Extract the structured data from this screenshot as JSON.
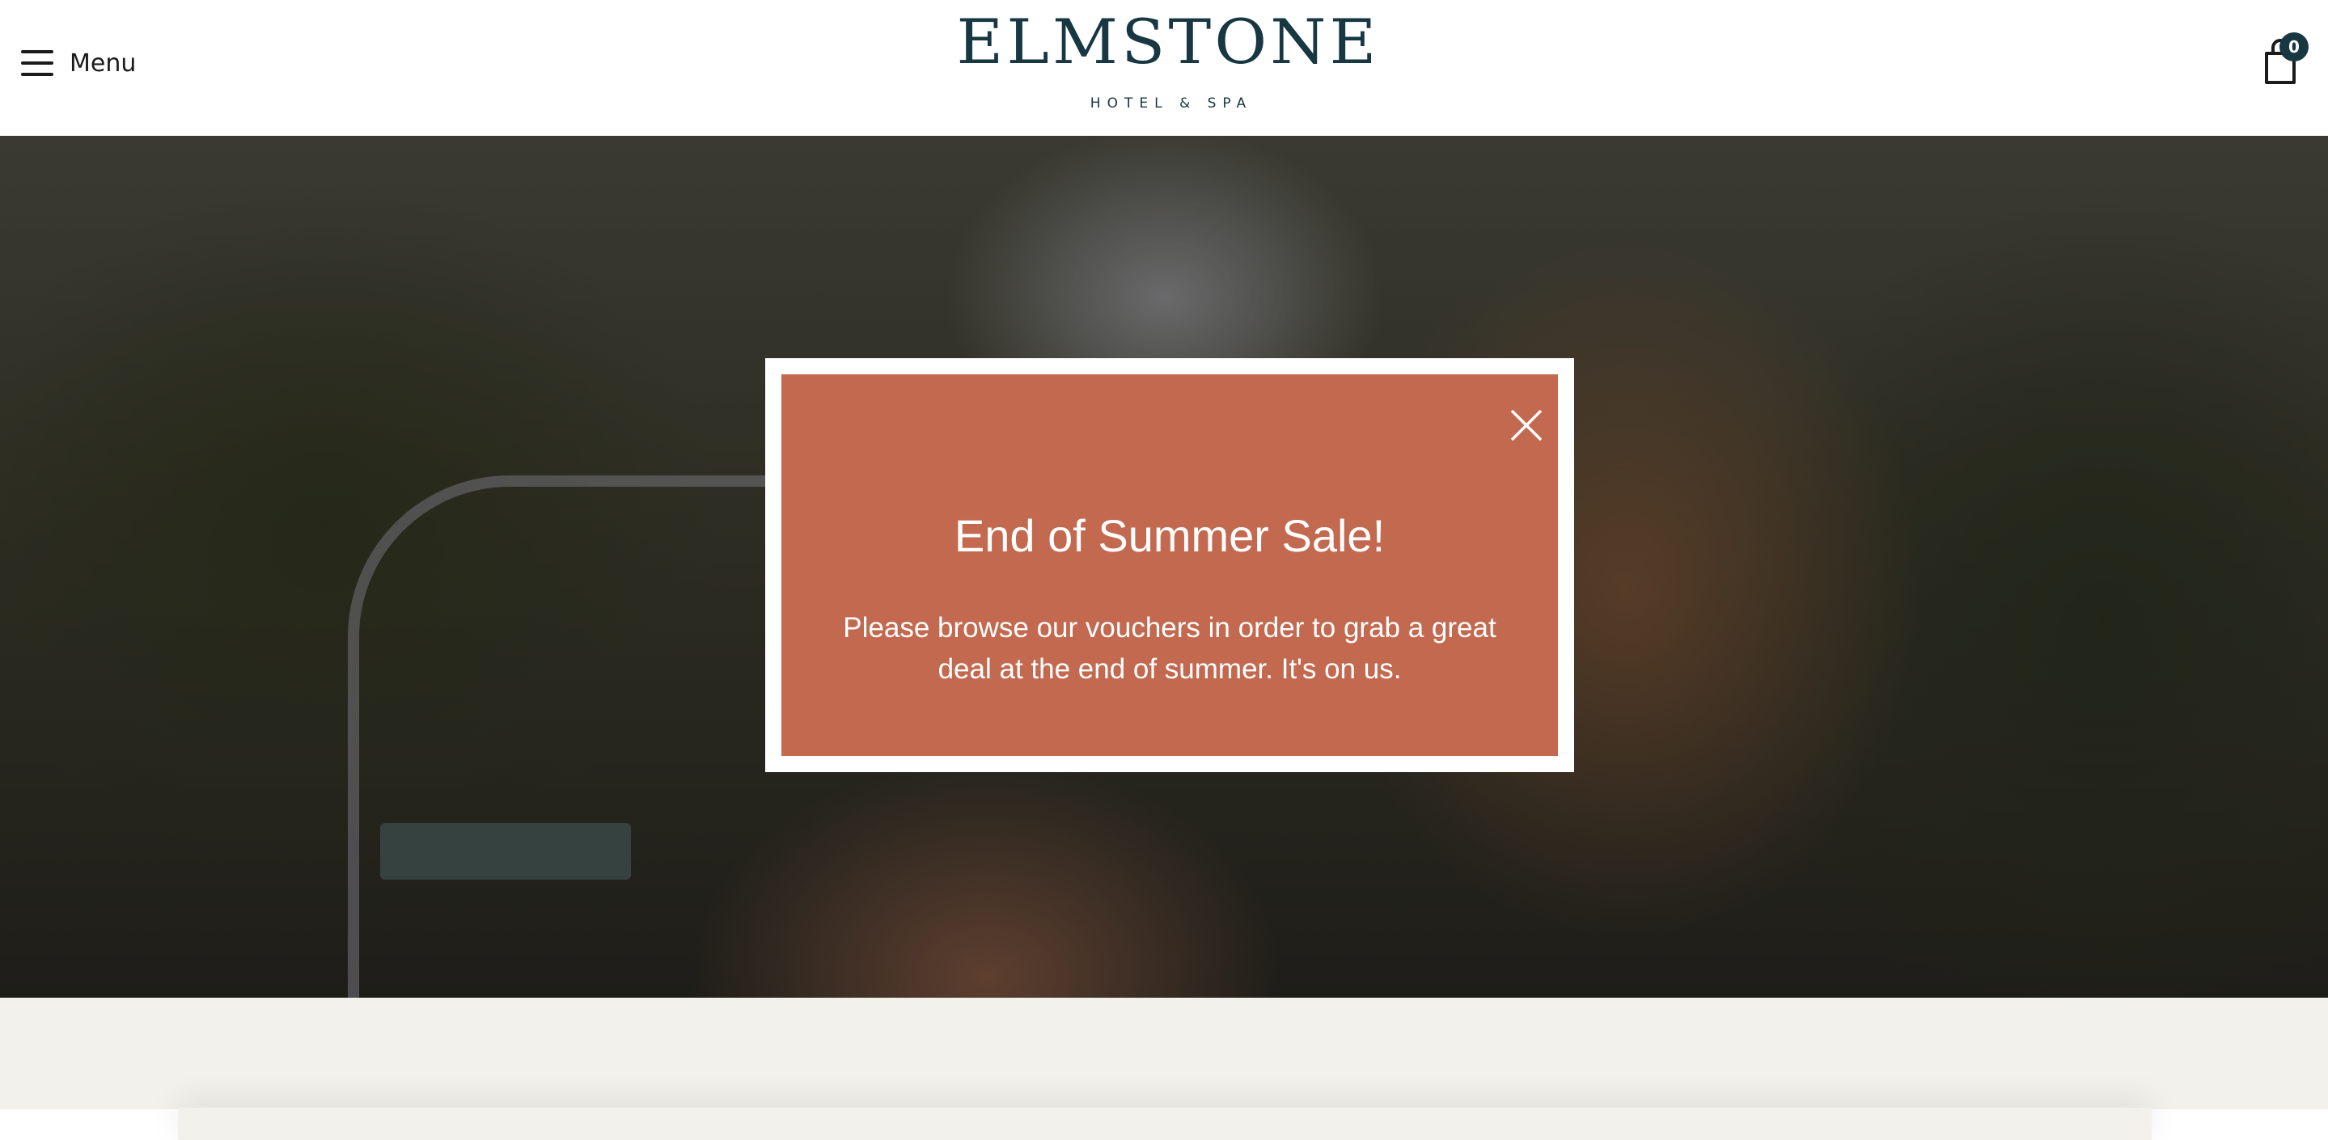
{
  "header": {
    "menu_label": "Menu",
    "menu_icon": "hamburger-icon",
    "logo_name": "ELMSTONE",
    "logo_subtitle": "HOTEL & SPA",
    "cart_icon": "shopping-bag-icon",
    "cart_count": "0"
  },
  "hero": {
    "image": "trees-street-sunlight-photo"
  },
  "popup": {
    "title": "End of Summer Sale!",
    "text": "Please browse our vouchers in order to grab a great deal at the end of summer. It's on us.",
    "close_icon": "close-icon"
  },
  "colors": {
    "brand_dark": "#173742",
    "popup_background": "#c3694f",
    "page_background": "#f3f1ec"
  }
}
